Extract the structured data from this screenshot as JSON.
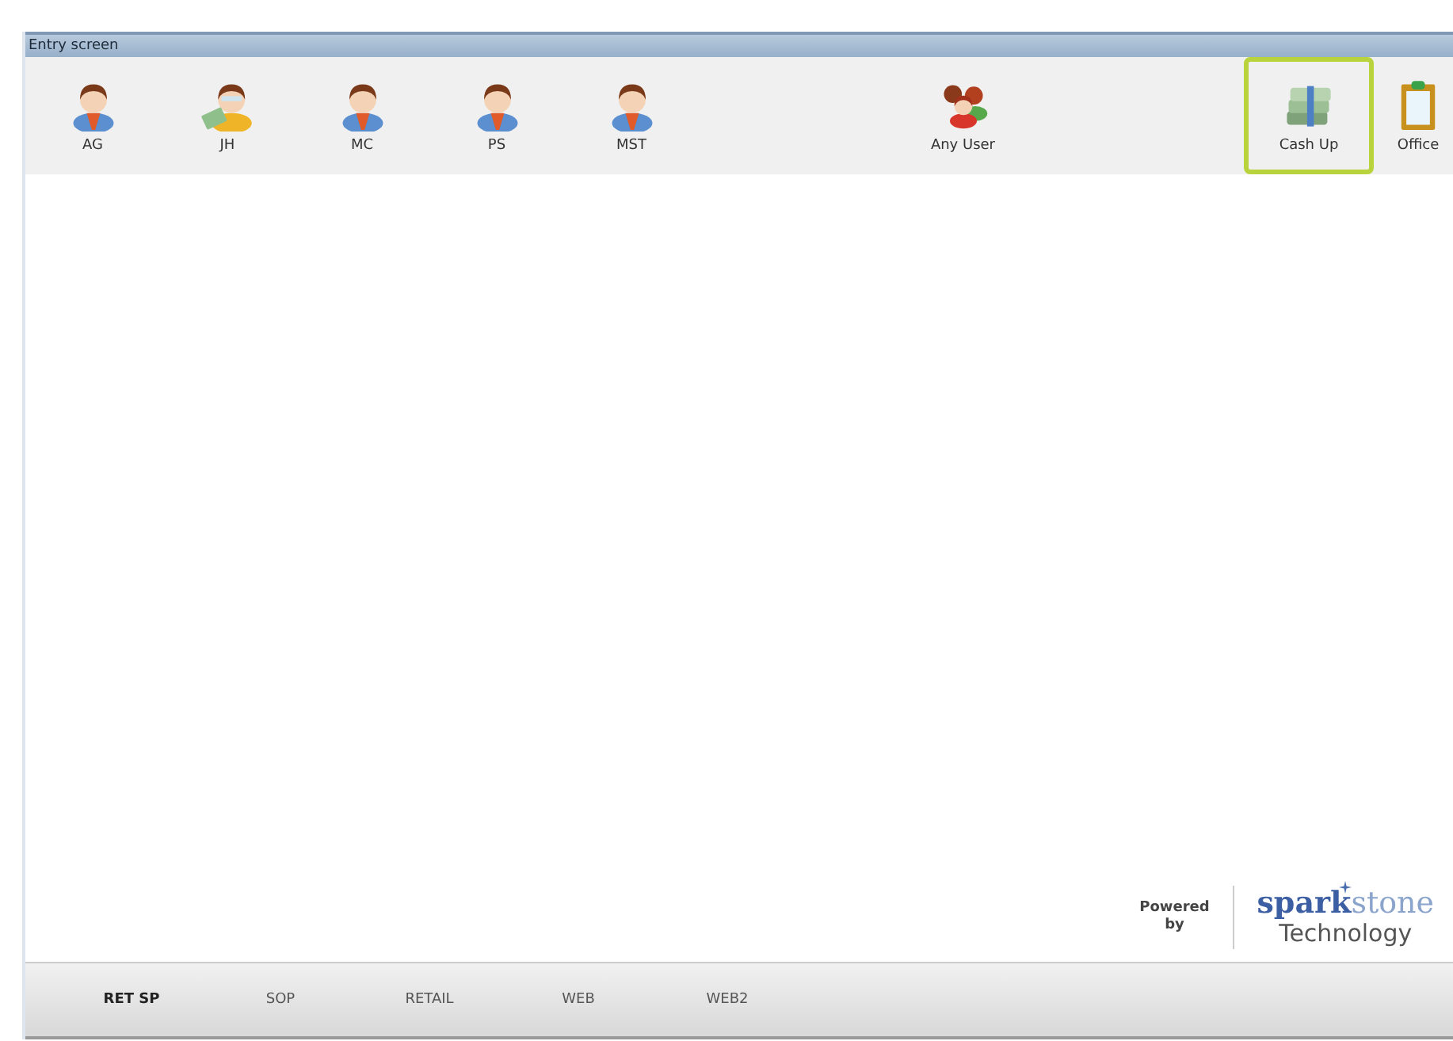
{
  "window": {
    "title": "Entry screen"
  },
  "toolbar": {
    "users": [
      {
        "label": "AG",
        "kind": "user"
      },
      {
        "label": "JH",
        "kind": "cashier"
      },
      {
        "label": "MC",
        "kind": "user"
      },
      {
        "label": "PS",
        "kind": "user"
      },
      {
        "label": "MST",
        "kind": "user"
      }
    ],
    "shared": [
      {
        "label": "Any User",
        "kind": "group"
      }
    ],
    "tools": [
      {
        "label": "Cash Up",
        "kind": "money",
        "highlighted": true
      },
      {
        "label": "Office",
        "kind": "clipboard",
        "highlighted": false
      }
    ]
  },
  "branding": {
    "powered_by": "Powered by",
    "name_strong": "spark",
    "name_light": "stone",
    "tagline": "Technology"
  },
  "tabs": [
    {
      "label": "RET SP",
      "selected": true
    },
    {
      "label": "SOP",
      "selected": false
    },
    {
      "label": "RETAIL",
      "selected": false
    },
    {
      "label": "WEB",
      "selected": false
    },
    {
      "label": "WEB2",
      "selected": false
    }
  ]
}
